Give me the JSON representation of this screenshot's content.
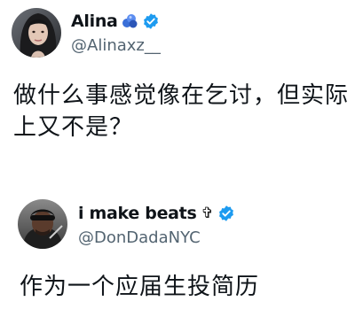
{
  "tweets": [
    {
      "display_name": "Alina",
      "name_emoji": "blue-balloons",
      "verified": true,
      "handle": "@Alinaxz__",
      "text_line1": "做什么事感觉像在乞讨，但实际",
      "text_line2": "上又不是？"
    },
    {
      "display_name": "i make beats",
      "name_symbol": "✞",
      "verified": true,
      "handle": "@DonDadaNYC",
      "text_line1": "作为一个应届生投简历"
    }
  ],
  "colors": {
    "verified_badge": "#1d9bf0",
    "handle": "#536471",
    "text": "#0f1419"
  }
}
